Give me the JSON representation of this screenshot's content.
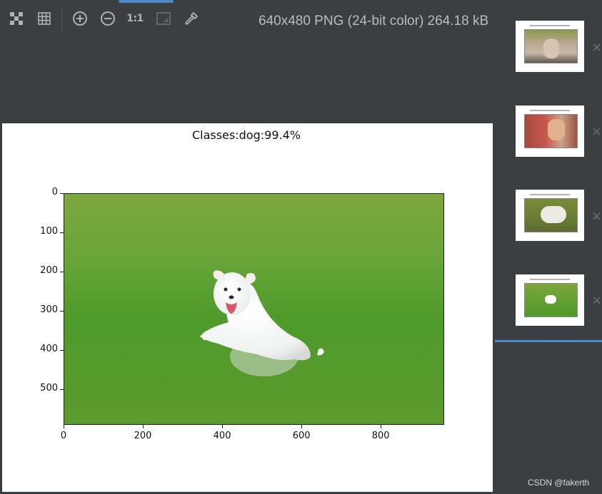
{
  "toolbar": {
    "buttons": [
      {
        "icon": "transparency-chessboard-icon"
      },
      {
        "icon": "grid-icon"
      },
      {
        "icon": "zoom-in-icon"
      },
      {
        "icon": "zoom-out-icon"
      },
      {
        "icon": "actual-size-icon",
        "label": "1:1"
      },
      {
        "icon": "fit-zoom-icon"
      },
      {
        "icon": "color-picker-icon"
      }
    ],
    "image_info": "640x480 PNG (24-bit color) 264.18 kB"
  },
  "plot": {
    "title": "Classes:dog:99.4%",
    "y_ticks": [
      "0",
      "100",
      "200",
      "300",
      "400",
      "500"
    ],
    "x_ticks": [
      "0",
      "200",
      "400",
      "600",
      "800"
    ]
  },
  "chart_data": {
    "type": "image",
    "title": "Classes:dog:99.4%",
    "xlim": [
      0,
      960
    ],
    "ylim": [
      590,
      0
    ],
    "x_ticks": [
      0,
      200,
      400,
      600,
      800
    ],
    "y_ticks": [
      0,
      100,
      200,
      300,
      400,
      500
    ]
  },
  "thumbnails": [
    {
      "subject": "cat on deck",
      "selected": false
    },
    {
      "subject": "cat on red",
      "selected": false
    },
    {
      "subject": "dog on grass",
      "selected": false
    },
    {
      "subject": "puppy on grass",
      "selected": true
    }
  ],
  "colors": {
    "accent": "#4a88c7",
    "background": "#3c3f41",
    "grass": "#5d9a2e"
  },
  "watermark": "CSDN @fakerth"
}
